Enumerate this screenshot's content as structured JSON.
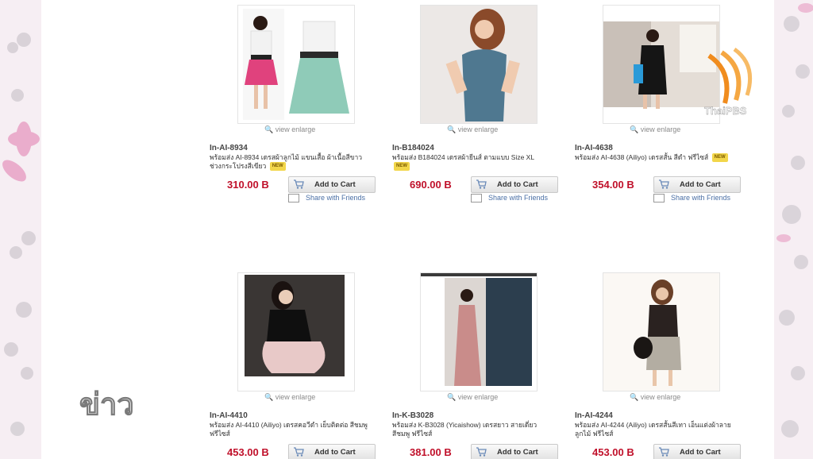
{
  "common": {
    "view_enlarge": "view enlarge",
    "add_to_cart": "Add to Cart",
    "share_with_friends": "Share with Friends",
    "new_badge": "NEW"
  },
  "products": [
    {
      "code": "In-AI-8934",
      "desc": "พร้อมส่ง AI-8934 เดรสผ้าลูกไม้ แขนเสื้อ ผ้าเนื้อสีขาว ช่วงกระโปรงสีเขียว",
      "price": "310.00 B"
    },
    {
      "code": "In-B184024",
      "desc": "พร้อมส่ง B184024 เดรสผ้ายีนส์ ตามแบบ Size XL",
      "price": "690.00 B"
    },
    {
      "code": "In-AI-4638",
      "desc": "พร้อมส่ง AI-4638 (Ailiyo) เดรสสั้น สีดำ ฟรีไซส์",
      "price": "354.00 B"
    },
    {
      "code": "In-AI-4410",
      "desc": "พร้อมส่ง AI-4410 (Ailiyo) เดรสคอวีดำ เย็บติดต่อ สีชมพู ฟรีไซส์",
      "price": "453.00 B"
    },
    {
      "code": "In-K-B3028",
      "desc": "พร้อมส่ง K-B3028 (Yicaishow) เดรสยาว สายเดี่ยว สีชมพู ฟรีไซส์",
      "price": "381.00 B"
    },
    {
      "code": "In-AI-4244",
      "desc": "พร้อมส่ง AI-4244 (Ailiyo) เดรสสั้นสีเทา เอ็นแต่งผ้าลายลูกไม้ ฟรีไซส์",
      "price": "453.00 B"
    }
  ],
  "overlay": {
    "channel_logo": "ThaiPBS",
    "program_logo": "ข่าว"
  },
  "colors": {
    "price": "#c0102a",
    "link": "#4a6fa5",
    "accent_orange": "#f08c1e"
  }
}
